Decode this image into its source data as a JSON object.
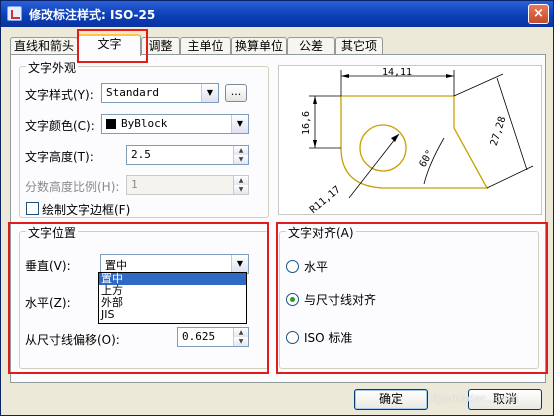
{
  "window": {
    "title": "修改标注样式: ISO-25",
    "close_label": "×"
  },
  "tabs": [
    {
      "label": "直线和箭头"
    },
    {
      "label": "文字"
    },
    {
      "label": "调整"
    },
    {
      "label": "主单位"
    },
    {
      "label": "换算单位"
    },
    {
      "label": "公差"
    },
    {
      "label": "其它项"
    }
  ],
  "text_appearance": {
    "group_title": "文字外观",
    "style_label": "文字样式(Y):",
    "style_value": "Standard",
    "browse_label": "...",
    "color_label": "文字颜色(C):",
    "color_value": "ByBlock",
    "height_label": "文字高度(T):",
    "height_value": "2.5",
    "fraction_label": "分数高度比例(H):",
    "fraction_value": "1",
    "frame_label": "绘制文字边框(F)"
  },
  "text_position": {
    "group_title": "文字位置",
    "vertical_label": "垂直(V):",
    "vertical_value": "置中",
    "vertical_options": [
      "置中",
      "上方",
      "外部",
      "JIS"
    ],
    "horizontal_label": "水平(Z):",
    "offset_label": "从尺寸线偏移(O):",
    "offset_value": "0.625"
  },
  "text_alignment": {
    "group_title": "文字对齐(A)",
    "options": [
      "水平",
      "与尺寸线对齐",
      "ISO 标准"
    ],
    "selected": "与尺寸线对齐"
  },
  "preview": {
    "dim_top": "14,11",
    "dim_left": "16,6",
    "dim_right": "27,28",
    "dim_angle": "60°",
    "dim_radius": "R11,17"
  },
  "buttons": {
    "ok": "确定",
    "cancel": "取消"
  },
  "watermark": "tigercoder...com",
  "colors": {
    "annotation": "#e21b1b",
    "preview_line": "#c8a000",
    "dim_line": "#000000"
  }
}
